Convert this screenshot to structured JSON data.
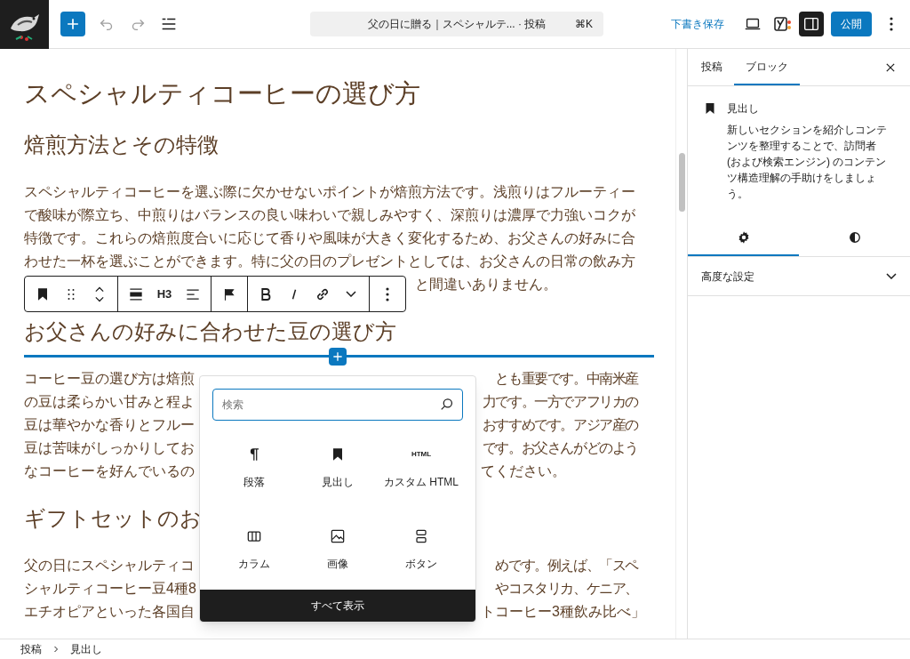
{
  "header": {
    "command_title": "父の日に贈る｜スペシャルテ... · 投稿",
    "shortcut": "⌘K",
    "save_draft": "下書き保存",
    "publish": "公開",
    "undo_disabled": true,
    "redo_disabled": true,
    "sidebar_toggle_pressed": true
  },
  "editor": {
    "blocks": [
      {
        "kind": "h2",
        "text": "スペシャルティコーヒーの選び方"
      },
      {
        "kind": "h3",
        "text": "焙煎方法とその特徴"
      },
      {
        "kind": "paragraph",
        "lines": [
          {
            "left": "スペシャルティコーヒーを選ぶ際に欠かせないポイントが焙煎方法です。浅煎りはフルーティー"
          },
          {
            "left": "で酸味が際立ち、中煎りはバランスの良い味わいで親しみやすく、深煎りは濃厚で力強いコクが"
          },
          {
            "left": "特徴です。これらの焙煎度合いに応じて香りや風味が大きく変化するため、お父さんの好みに合"
          },
          {
            "left": "わせた一杯を選ぶことができます。特に父の日のプレゼントとしては、お父さんの日常の飲み方"
          },
          {
            "right": "と間違いありません。"
          }
        ]
      },
      {
        "kind": "h3",
        "text": "お父さんの好みに合わせた豆の選び方"
      },
      {
        "kind": "paragraph",
        "lines": [
          {
            "left": "コーヒー豆の選び方は焙煎",
            "right": "とも重要です。中南米産"
          },
          {
            "left": "の豆は柔らかい甘みと程よ",
            "right": "力です。一方でアフリカの"
          },
          {
            "left": "豆は華やかな香りとフルー",
            "right": "おすすめです。アジア産の"
          },
          {
            "left": "豆は苦味がしっかりしてお",
            "right": "です。お父さんがどのよう"
          },
          {
            "left": "なコーヒーを好んでいるの",
            "right": "てください。"
          }
        ]
      },
      {
        "kind": "h3",
        "text": "ギフトセットのお"
      },
      {
        "kind": "paragraph",
        "lines": [
          {
            "left": "父の日にスペシャルティコ",
            "right": "めです。例えば、「スペ"
          },
          {
            "left": "シャルティコーヒー豆4種8",
            "right": "やコスタリカ、ケニア、"
          },
          {
            "left": "エチオピアといった各国自",
            "right": "トコーヒー3種飲み比べ」"
          }
        ]
      }
    ]
  },
  "block_toolbar": {
    "level": "H3"
  },
  "inserter": {
    "search_placeholder": "検索",
    "items": [
      {
        "kind": "paragraph",
        "label": "段落"
      },
      {
        "kind": "heading",
        "label": "見出し"
      },
      {
        "kind": "html",
        "label": "カスタム HTML",
        "glyph": "HTML"
      },
      {
        "kind": "columns",
        "label": "カラム"
      },
      {
        "kind": "image",
        "label": "画像"
      },
      {
        "kind": "buttons",
        "label": "ボタン"
      }
    ],
    "browse_all": "すべて表示"
  },
  "sidebar": {
    "tabs": [
      {
        "label": "投稿",
        "selected": false
      },
      {
        "label": "ブロック",
        "selected": true
      }
    ],
    "block": {
      "title": "見出し",
      "description": "新しいセクションを紹介しコンテンツを整理することで、訪問者 (および検索エンジン) のコンテンツ構造理解の手助けをしましょう。"
    },
    "subtabs": [
      {
        "kind": "settings",
        "selected": true
      },
      {
        "kind": "styles",
        "selected": false
      }
    ],
    "advanced": "高度な設定"
  },
  "breadcrumb": [
    "投稿",
    "見出し"
  ]
}
